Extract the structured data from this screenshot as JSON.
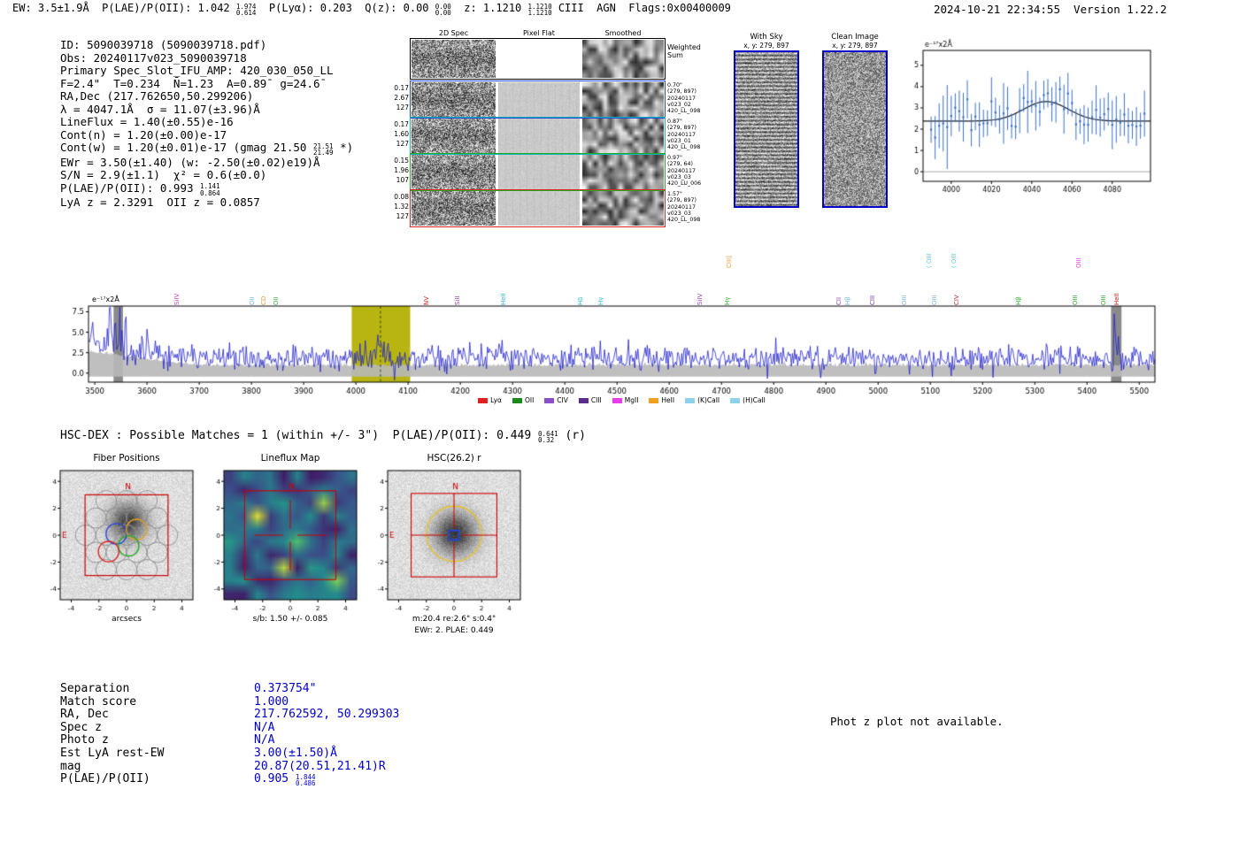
{
  "header": {
    "parts": [
      {
        "t": "EW: 3.5±1.9Å  P(LAE)/P(OII): 1.042 "
      },
      {
        "frac": [
          "1.974",
          "0.614"
        ]
      },
      {
        "t": "  P(Lyα): 0.203  Q(z): 0.00 "
      },
      {
        "frac": [
          "0.00",
          "0.00"
        ]
      },
      {
        "t": "  z: 1.1210 "
      },
      {
        "frac": [
          "1.1210",
          "1.1210"
        ]
      },
      {
        "t": " CIII  AGN  Flags:0x00400009"
      }
    ],
    "right": "2024-10-21 22:34:55  Version 1.22.2"
  },
  "info": {
    "lines": [
      [
        {
          "t": "ID: 5090039718 (5090039718.pdf)"
        }
      ],
      [
        {
          "t": "Obs: 20240117v023_5090039718"
        }
      ],
      [
        {
          "t": "Primary Spec_Slot_IFU_AMP: 420_030_050_LL"
        }
      ],
      [
        {
          "t": "F=2.4\"  T=0.234  N̄=1.23  A=0.89̄  g=24.6̄"
        }
      ],
      [
        {
          "t": "RA,Dec (217.762650,50.299206)"
        }
      ],
      [
        {
          "t": "λ = 4047.1Å  σ = 11.07(±3.96)Å"
        }
      ],
      [
        {
          "t": "LineFlux = 1.40(±0.55)e-16"
        }
      ],
      [
        {
          "t": "Cont(n) = 1.20(±0.00)e-17"
        }
      ],
      [
        {
          "t": "Cont(w) = 1.20(±0.01)e-17 (gmag 21.50 "
        },
        {
          "frac": [
            "21.51",
            "21.49"
          ]
        },
        {
          "t": " *)"
        }
      ],
      [
        {
          "t": "EWr = 3.50(±1.40) (w: -2.50(±0.02)e19)Å"
        }
      ],
      [
        {
          "t": "S/N = 2.9(±1.1)  χ² = 0.6(±0.0)"
        }
      ],
      [
        {
          "t": "P(LAE)/P(OII): 0.993 "
        },
        {
          "frac": [
            "1.141",
            "0.864"
          ]
        }
      ],
      [
        {
          "t": "LyA z = 2.3291  OII z = 0.0857"
        }
      ]
    ]
  },
  "spec2d": {
    "col_headers": [
      "2D Spec",
      "Pixel Flat",
      "Smoothed"
    ],
    "rows": [
      {
        "border": "#000000",
        "left": [],
        "right": [
          "Weighted",
          "Sum"
        ],
        "big_right": true
      },
      {
        "border": "#2244dd",
        "left": [
          "0.17",
          "2.67",
          "127"
        ],
        "right": [
          "0.70\"",
          "(279, 897)",
          "20240117",
          "v023_02",
          "420_LL_098"
        ]
      },
      {
        "border": "#11b5b5",
        "left": [
          "0.17",
          "1.60",
          "127"
        ],
        "right": [
          "0.87\"",
          "(279, 897)",
          "20240117",
          "v023_01",
          "420_LL_098"
        ]
      },
      {
        "border": "#22aa22",
        "left": [
          "0.15",
          "1.96",
          "107"
        ],
        "right": [
          "0.97\"",
          "(279, 64)",
          "20240117",
          "v023_03",
          "420_LU_006"
        ]
      },
      {
        "border": "#dd2222",
        "left": [
          "0.08",
          "1.32",
          "127"
        ],
        "right": [
          "1.57\"",
          "(279, 897)",
          "20240117",
          "v023_03",
          "420_LL_098"
        ]
      }
    ]
  },
  "withsky": {
    "title": "With Sky",
    "subtitle": "x, y: 279, 897"
  },
  "clean": {
    "title": "Clean Image",
    "subtitle": "x, y: 279, 897"
  },
  "hscdex": {
    "parts": [
      {
        "t": "HSC-DEX : Possible Matches = 1 (within +/- 3\")  P(LAE)/P(OII): 0.449 "
      },
      {
        "frac": [
          "0.641",
          "0.32"
        ]
      },
      {
        "t": " (r)"
      }
    ]
  },
  "match_table": {
    "value_color": "#0000cd",
    "rows": [
      {
        "label": "Separation",
        "value": [
          {
            "t": "0.373754\""
          }
        ]
      },
      {
        "label": "Match score",
        "value": [
          {
            "t": "1.000"
          }
        ]
      },
      {
        "label": "RA, Dec",
        "value": [
          {
            "t": "217.762592, 50.299303"
          }
        ]
      },
      {
        "label": "Spec z",
        "value": [
          {
            "t": "N/A"
          }
        ]
      },
      {
        "label": "Photo z",
        "value": [
          {
            "t": "N/A"
          }
        ]
      },
      {
        "label": "Est LyA rest-EW",
        "value": [
          {
            "t": "3.00(±1.50)Å"
          }
        ]
      },
      {
        "label": "mag",
        "value": [
          {
            "t": "20.87(20.51,21.41)R"
          }
        ]
      },
      {
        "label": "P(LAE)/P(OII)",
        "value": [
          {
            "t": "0.905 "
          },
          {
            "frac": [
              "1.844",
              "0.486"
            ]
          }
        ]
      }
    ]
  },
  "photz_note": "Phot z plot not available.",
  "chart_data": [
    {
      "id": "line_fit_zoom",
      "type": "scatter",
      "title": "",
      "units_label": "e⁻¹⁷x2Å",
      "x_range": [
        3986,
        4099
      ],
      "x_ticks": [
        4000,
        4020,
        4040,
        4060,
        4080
      ],
      "y_range": [
        -0.45,
        5.7
      ],
      "y_ticks": [
        0,
        1,
        2,
        3,
        4,
        5
      ],
      "fit": {
        "mu": 4047.1,
        "sigma": 11.07,
        "amplitude": 0.92,
        "continuum": 2.38
      },
      "point_color": "#3a6fc4",
      "fit_color": "#1a1a1a"
    },
    {
      "id": "full_spectrum",
      "type": "line",
      "units_label": "e⁻¹⁷x2Å",
      "x_range": [
        3488,
        5530
      ],
      "x_ticks": [
        3500,
        3600,
        3700,
        3800,
        3900,
        4000,
        4100,
        4200,
        4300,
        4400,
        4500,
        4600,
        4700,
        4800,
        4900,
        5000,
        5100,
        5200,
        5300,
        5400,
        5500
      ],
      "y_range": [
        -1.1,
        8.2
      ],
      "y_ticks": [
        0.0,
        2.5,
        5.0,
        7.5
      ],
      "emission_line_wave": 4047.1,
      "highlight_band": {
        "x0": 3992,
        "x1": 4104,
        "color": "#b8b512"
      },
      "gray_bands": [
        [
          3536,
          3554
        ],
        [
          5446,
          5466
        ]
      ],
      "trace_color": "#2222cc",
      "error_fill": "#b8b8b8",
      "line_labels": [
        {
          "wave": 3656,
          "label": "SiIV",
          "color": "#bb44bb",
          "row": 0
        },
        {
          "wave": 3800,
          "label": "OII",
          "color": "#77bbdd",
          "row": 0
        },
        {
          "wave": 3822,
          "label": "CD",
          "color": "#ee9933",
          "row": 0
        },
        {
          "wave": 3846,
          "label": "OII",
          "color": "#44aa44",
          "row": 0
        },
        {
          "wave": 4133,
          "label": "NV",
          "color": "#cc2222",
          "row": 0
        },
        {
          "wave": 4193,
          "label": "SiII",
          "color": "#9944aa",
          "row": 0
        },
        {
          "wave": 4281,
          "label": "HeII",
          "color": "#33bbcc",
          "row": 0
        },
        {
          "wave": 4428,
          "label": "Hδ",
          "color": "#33bbcc",
          "row": 0
        },
        {
          "wave": 4468,
          "label": "Hγ",
          "color": "#33bbcc",
          "row": 0
        },
        {
          "wave": 4657,
          "label": "SiIV",
          "color": "#9944aa",
          "row": 0
        },
        {
          "wave": 4710,
          "label": "Hγ",
          "color": "#33aa33",
          "row": 0
        },
        {
          "wave": 4713,
          "label": "CIII]",
          "color": "#ee9933",
          "row": 1
        },
        {
          "wave": 4923,
          "label": "CII",
          "color": "#9944aa",
          "row": 0
        },
        {
          "wave": 4941,
          "label": "Hβ",
          "color": "#77bbdd",
          "row": 0
        },
        {
          "wave": 4988,
          "label": "CIII",
          "color": "#7733aa",
          "row": 0
        },
        {
          "wave": 5049,
          "label": "OIII",
          "color": "#77bbdd",
          "row": 0
        },
        {
          "wave": 5097,
          "label": "( OIII",
          "color": "#66ccdd",
          "row": 1
        },
        {
          "wave": 5106,
          "label": "OIII",
          "color": "#77bbdd",
          "row": 0
        },
        {
          "wave": 5144,
          "label": "( OIII",
          "color": "#66ccdd",
          "row": 1
        },
        {
          "wave": 5149,
          "label": "CIV",
          "color": "#aa3333",
          "row": 0
        },
        {
          "wave": 5268,
          "label": "Hβ",
          "color": "#33aa33",
          "row": 0
        },
        {
          "wave": 5376,
          "label": "OIII",
          "color": "#33aa33",
          "row": 0
        },
        {
          "wave": 5383,
          "label": "OIII",
          "color": "#dd44dd",
          "row": 1
        },
        {
          "wave": 5430,
          "label": "OIII",
          "color": "#33aa33",
          "row": 0
        },
        {
          "wave": 5456,
          "label": "HeII",
          "color": "#cc2222",
          "row": 0
        }
      ],
      "legend": [
        {
          "label": "Lyα",
          "color": "#e02020"
        },
        {
          "label": "OII",
          "color": "#1a8a1a"
        },
        {
          "label": "CIV",
          "color": "#8a4fc8"
        },
        {
          "label": "CIII",
          "color": "#5a2d8a"
        },
        {
          "label": "MgII",
          "color": "#e83ce8"
        },
        {
          "label": "HeII",
          "color": "#efa021"
        },
        {
          "label": "(K)CaII",
          "color": "#8fd0ea"
        },
        {
          "label": "(H)CaII",
          "color": "#8fd0ea"
        }
      ]
    },
    {
      "id": "fiber_positions",
      "type": "image",
      "title": "Fiber Positions",
      "xlabel": "arcsecs",
      "axis_ticks": [
        -4,
        -2,
        0,
        2,
        4
      ],
      "axis_range": [
        -4.8,
        4.8
      ],
      "compass": {
        "n": "N",
        "e": "E",
        "color": "#cc0000"
      },
      "ifu_box": {
        "half": 3.0,
        "color": "#cc0000"
      },
      "fiber_radius": 0.74,
      "fiber_color": "#909090",
      "fiber_centers": [
        [
          -1.48,
          2.56
        ],
        [
          0,
          2.56
        ],
        [
          1.48,
          2.56
        ],
        [
          -2.22,
          1.28
        ],
        [
          -0.74,
          1.28
        ],
        [
          0.74,
          1.28
        ],
        [
          2.22,
          1.28
        ],
        [
          -2.96,
          0
        ],
        [
          -1.48,
          0
        ],
        [
          0,
          0
        ],
        [
          1.48,
          0
        ],
        [
          2.96,
          0
        ],
        [
          -2.22,
          -1.28
        ],
        [
          -0.74,
          -1.28
        ],
        [
          0.74,
          -1.28
        ],
        [
          2.22,
          -1.28
        ],
        [
          -1.48,
          -2.56
        ],
        [
          0,
          -2.56
        ],
        [
          1.48,
          -2.56
        ]
      ],
      "selected_fibers": [
        {
          "x": -0.74,
          "y": 0.1,
          "color": "#2244dd"
        },
        {
          "x": 0.72,
          "y": 0.42,
          "color": "#e8a020"
        },
        {
          "x": 0.15,
          "y": -0.8,
          "color": "#22aa22"
        },
        {
          "x": -1.3,
          "y": -1.22,
          "color": "#dd2222"
        }
      ]
    },
    {
      "id": "lineflux_map",
      "type": "heatmap",
      "title": "Lineflux Map",
      "xlabel": "s/b: 1.50 +/- 0.085",
      "axis_ticks": [
        -4,
        -2,
        0,
        2,
        4
      ],
      "axis_range": [
        -4.8,
        4.8
      ],
      "compass": {
        "n": "N",
        "color": "#cc0000"
      },
      "crosshair_color": "#cc0000",
      "box": {
        "half": 3.3,
        "color": "#cc0000"
      },
      "palette": [
        "#440154",
        "#3b528b",
        "#21918c",
        "#5ec962",
        "#fde725"
      ]
    },
    {
      "id": "hsc_r",
      "type": "image",
      "title": "HSC(26.2) r",
      "xlabel": "m:20.4 re:2.6\" s:0.4\"",
      "xlabel2": "EWr: 2. PLAE: 0.449",
      "axis_ticks": [
        -4,
        -2,
        0,
        2,
        4
      ],
      "axis_range": [
        -4.8,
        4.8
      ],
      "compass": {
        "n": "N",
        "e": "E",
        "color": "#cc0000"
      },
      "aperture": {
        "radius": 2.0,
        "color": "#e8c229"
      },
      "catalog_box": {
        "half": 3.1,
        "color": "#cc0000"
      },
      "center_box": {
        "half": 0.35,
        "color": "#2244dd"
      },
      "crosshair_color": "#cc0000"
    }
  ]
}
